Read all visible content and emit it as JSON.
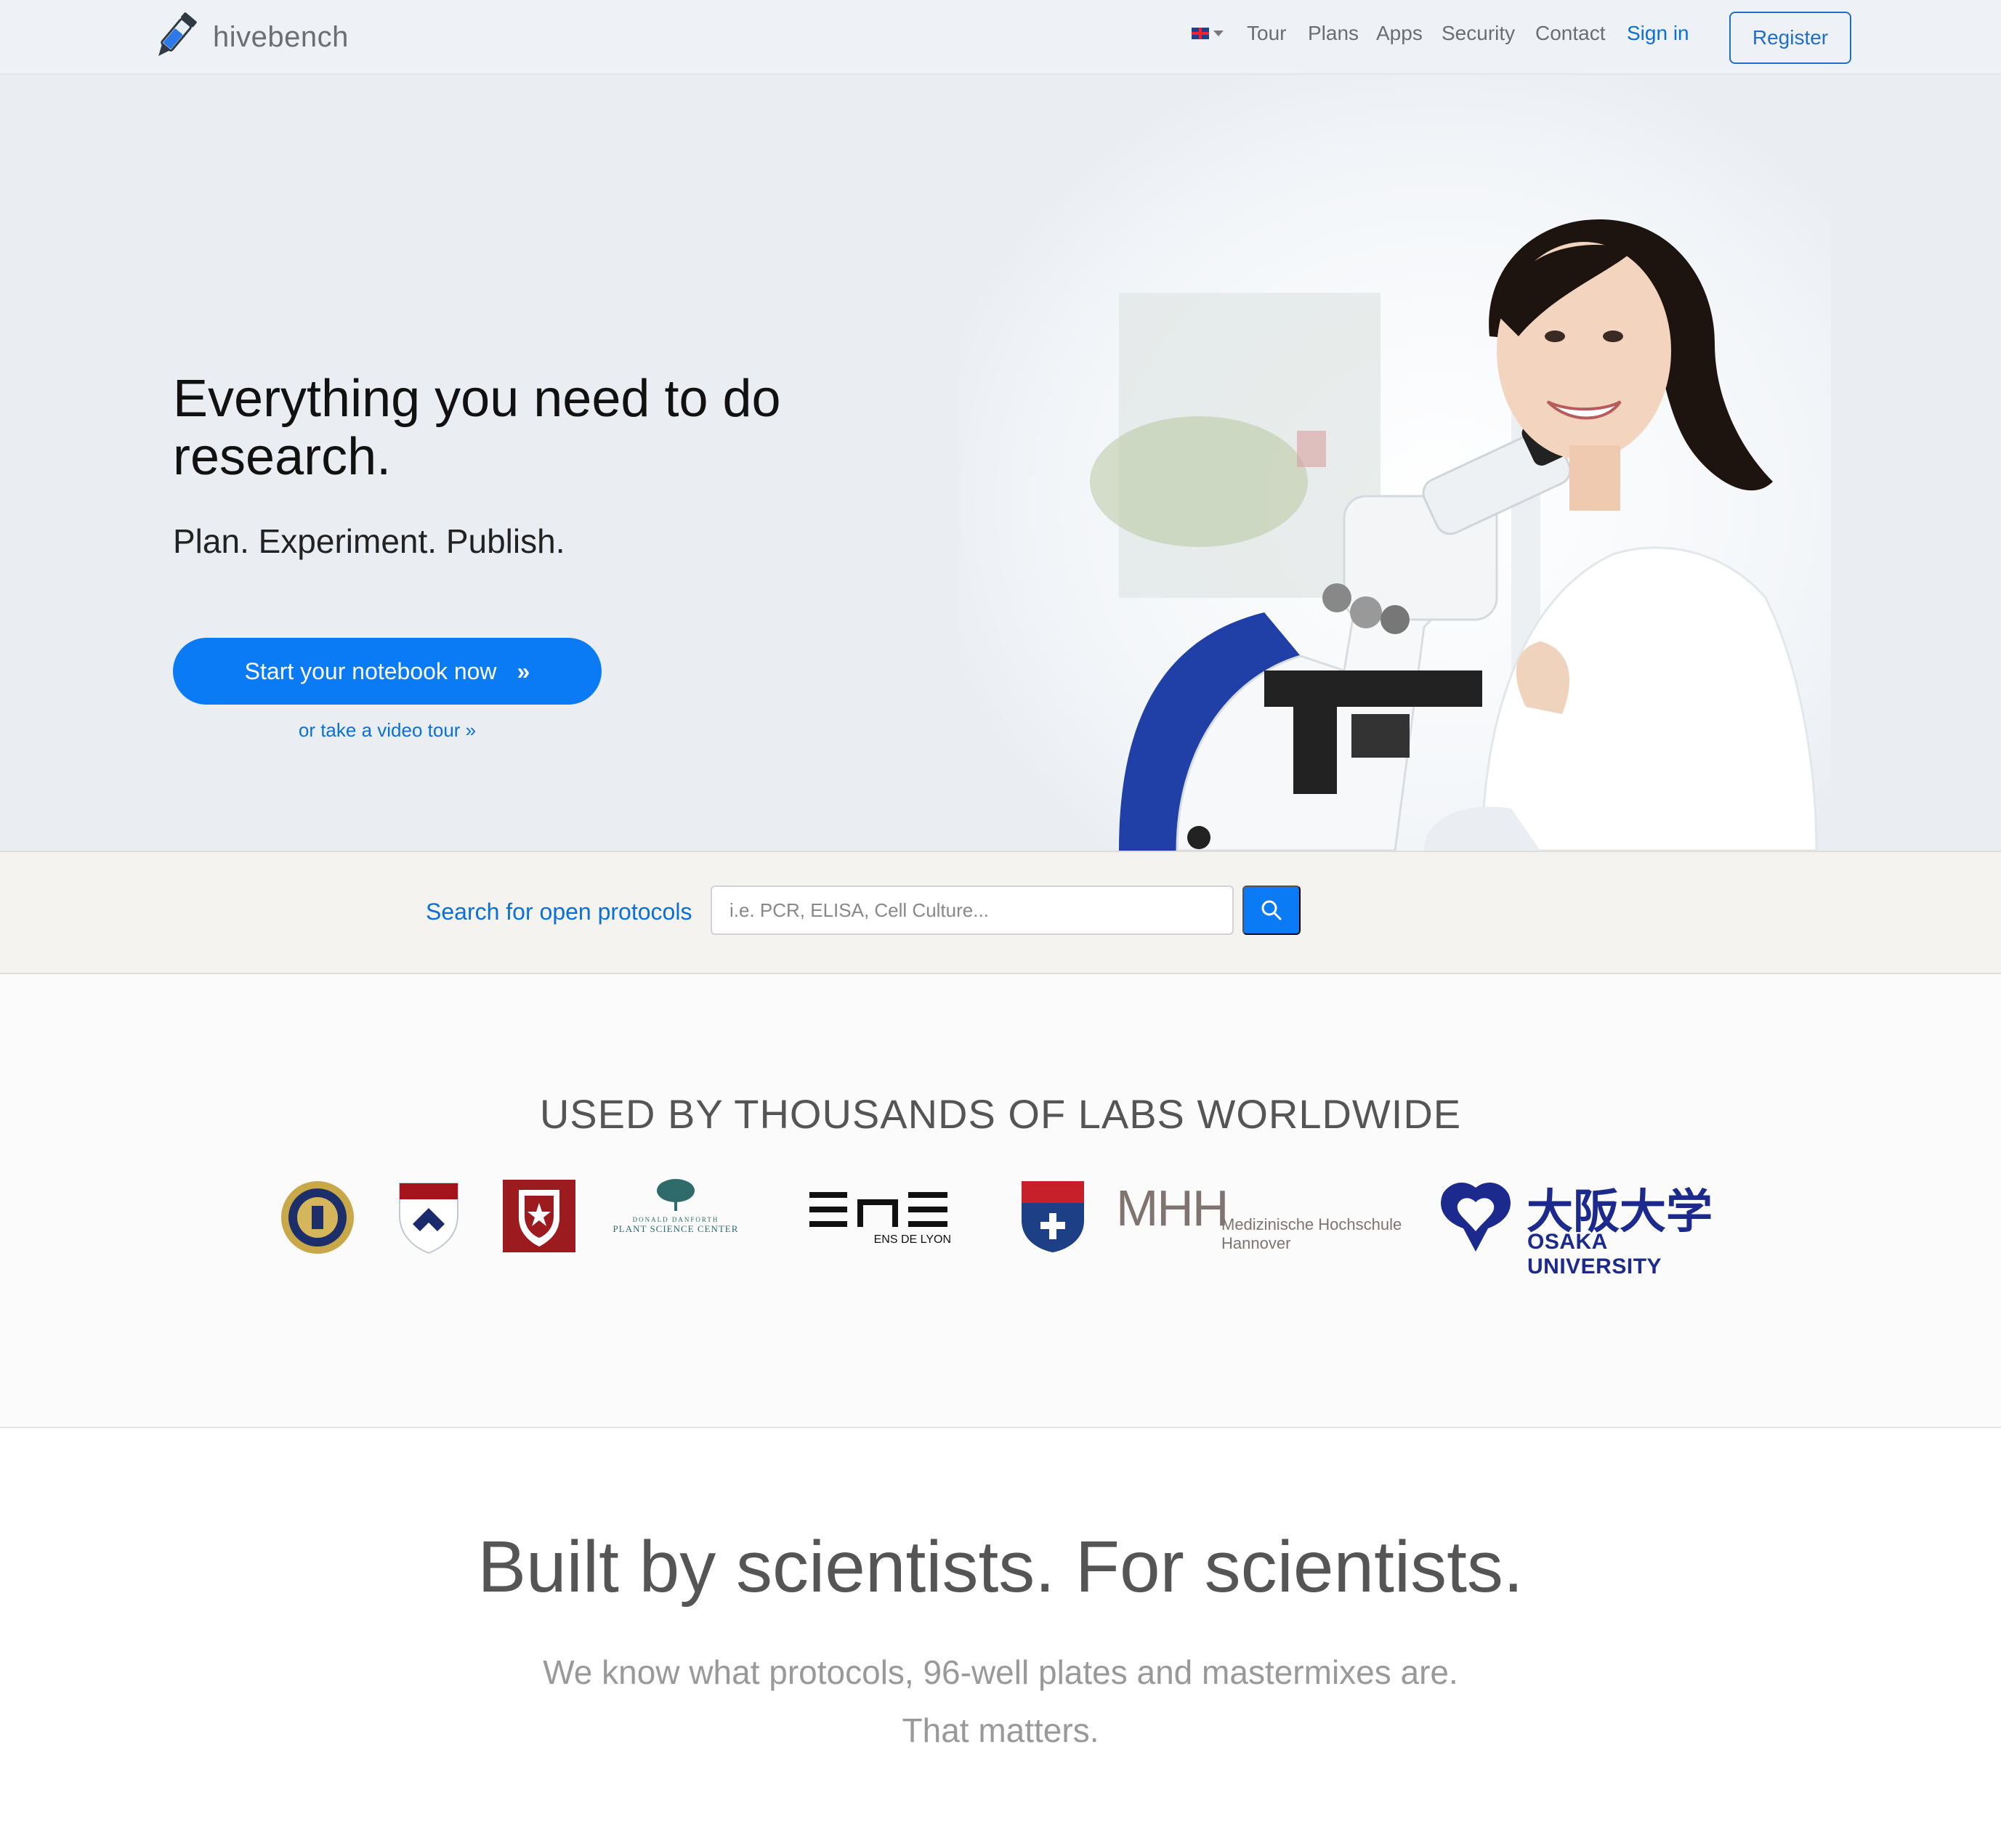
{
  "nav": {
    "brand": "hivebench",
    "language_icon": "uk-flag-icon",
    "items": [
      "Tour",
      "Plans",
      "Apps",
      "Security",
      "Contact"
    ],
    "signin": "Sign in",
    "register": "Register"
  },
  "hero": {
    "title": "Everything you need to do research.",
    "subtitle": "Plan. Experiment. Publish.",
    "cta_label": "Start your notebook now",
    "cta_arrow": "»",
    "video_link": "or take a video tour »"
  },
  "search": {
    "label": "Search for open protocols",
    "placeholder": "i.e. PCR, ELISA, Cell Culture...",
    "button_icon": "search-icon"
  },
  "logos": {
    "title": "USED BY THOUSANDS OF LABS WORLDWIDE",
    "ens_text": "ENS DE LYON",
    "danforth_line1": "DONALD DANFORTH",
    "danforth_line2": "PLANT SCIENCE CENTER",
    "mhh_mark": "MHH",
    "mhh_line1": "Medizinische Hochschule",
    "mhh_line2": "Hannover",
    "osaka_kanji": "大阪大学",
    "osaka_name": "OSAKA UNIVERSITY"
  },
  "built": {
    "title": "Built by scientists. For scientists.",
    "line1": "We know what protocols, 96-well plates and mastermixes are.",
    "line2": "That matters."
  },
  "colors": {
    "accent": "#0b7bf5",
    "link": "#0b6fd8",
    "hero_bg": "#eaeef3",
    "osaka_blue": "#1b2a8c"
  }
}
